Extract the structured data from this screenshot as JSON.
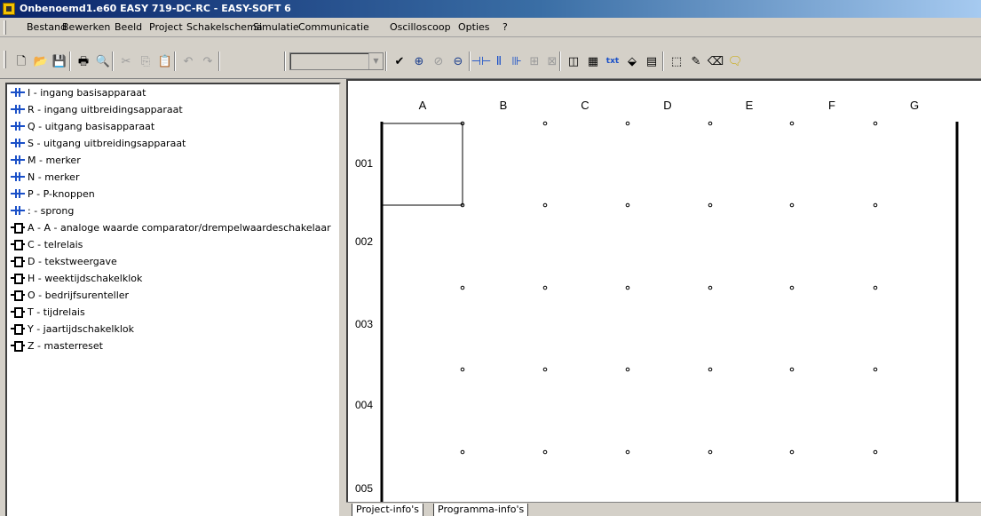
{
  "window": {
    "title": "Onbenoemd1.e60 EASY 719-DC-RC - EASY-SOFT 6"
  },
  "menu": [
    {
      "label": "Bestand"
    },
    {
      "label": "Bewerken"
    },
    {
      "label": "Beeld"
    },
    {
      "label": "Project"
    },
    {
      "label": "Schakelschema"
    },
    {
      "label": "Simulatie"
    },
    {
      "label": "Communicatie"
    },
    {
      "label": "Oscilloscoop"
    },
    {
      "label": "Opties"
    },
    {
      "label": "?"
    }
  ],
  "toolbar": {
    "zoom_value": "",
    "buttons": [
      {
        "name": "new-file-icon",
        "glyph": "🗋",
        "enabled": true
      },
      {
        "name": "open-folder-icon",
        "glyph": "📂",
        "enabled": true
      },
      {
        "name": "save-icon",
        "glyph": "💾",
        "enabled": true
      },
      {
        "name": "print-icon",
        "glyph": "🖶",
        "enabled": true
      },
      {
        "name": "print-preview-icon",
        "glyph": "🔍",
        "enabled": true
      },
      {
        "name": "cut-icon",
        "glyph": "✂",
        "enabled": false
      },
      {
        "name": "copy-icon",
        "glyph": "⎘",
        "enabled": false
      },
      {
        "name": "paste-icon",
        "glyph": "📋",
        "enabled": false
      },
      {
        "name": "undo-icon",
        "glyph": "↶",
        "enabled": false
      },
      {
        "name": "redo-icon",
        "glyph": "↷",
        "enabled": false
      },
      {
        "name": "check-program-icon",
        "glyph": "✔",
        "enabled": true
      },
      {
        "name": "zoom-in-icon",
        "glyph": "⊕",
        "enabled": true
      },
      {
        "name": "zoom-fit-icon",
        "glyph": "⊘",
        "enabled": false
      },
      {
        "name": "zoom-out-icon",
        "glyph": "⊖",
        "enabled": true
      },
      {
        "name": "contact-tool-icon",
        "glyph": "⊣⊢",
        "enabled": true
      },
      {
        "name": "negated-contact-tool-icon",
        "glyph": "Ⅱ",
        "enabled": true
      },
      {
        "name": "coil-tool-icon",
        "glyph": "⊪",
        "enabled": true
      },
      {
        "name": "function-block-tool-icon",
        "glyph": "⊞",
        "enabled": false
      },
      {
        "name": "delete-rung-icon",
        "glyph": "⊠",
        "enabled": false
      },
      {
        "name": "view-panel-icon",
        "glyph": "◫",
        "enabled": true
      },
      {
        "name": "grid-icon",
        "glyph": "▦",
        "enabled": true
      },
      {
        "name": "text-icon",
        "glyph": "txt",
        "enabled": true
      },
      {
        "name": "layout-icon",
        "glyph": "⬙",
        "enabled": true
      },
      {
        "name": "table-icon",
        "glyph": "▤",
        "enabled": true
      },
      {
        "name": "select-rect-icon",
        "glyph": "⬚",
        "enabled": true
      },
      {
        "name": "pencil-icon",
        "glyph": "✎",
        "enabled": true
      },
      {
        "name": "eraser-icon",
        "glyph": "⌫",
        "enabled": true
      },
      {
        "name": "comment-icon",
        "glyph": "🗨",
        "enabled": true
      }
    ]
  },
  "tree": [
    {
      "icon": "contact",
      "label": "I - ingang basisapparaat"
    },
    {
      "icon": "contact",
      "label": "R - ingang uitbreidingsapparaat"
    },
    {
      "icon": "contact",
      "label": "Q - uitgang basisapparaat"
    },
    {
      "icon": "contact",
      "label": "S - uitgang uitbreidingsapparaat"
    },
    {
      "icon": "contact",
      "label": "M  - merker"
    },
    {
      "icon": "contact",
      "label": "N - merker"
    },
    {
      "icon": "contact",
      "label": "P - P-knoppen"
    },
    {
      "icon": "contact",
      "label": ": - sprong"
    },
    {
      "icon": "block",
      "label": "A - A - analoge waarde comparator/drempelwaardeschakelaar"
    },
    {
      "icon": "block",
      "label": "C - telrelais"
    },
    {
      "icon": "block",
      "label": "D - tekstweergave"
    },
    {
      "icon": "block",
      "label": "H - weektijdschakelklok"
    },
    {
      "icon": "block",
      "label": "O - bedrijfsurenteller"
    },
    {
      "icon": "block",
      "label": "T - tijdrelais"
    },
    {
      "icon": "block",
      "label": "Y - jaartijdschakelklok"
    },
    {
      "icon": "block",
      "label": "Z - masterreset"
    }
  ],
  "diagram": {
    "columns": [
      "A",
      "B",
      "C",
      "D",
      "E",
      "F",
      "G"
    ],
    "rows": [
      "001",
      "002",
      "003",
      "004",
      "005"
    ],
    "selected_cell": {
      "column": "A",
      "row": "001"
    }
  },
  "tabs": [
    {
      "label": "Project-info's"
    },
    {
      "label": "Programma-info's"
    }
  ]
}
